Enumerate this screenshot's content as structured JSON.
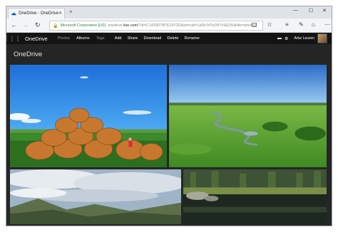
{
  "browser": {
    "tab_title": "OneDrive - OneDrive",
    "new_tab": "+",
    "address": {
      "certificate": "Microsoft Corporation [US]",
      "url_prefix": "onedrive.",
      "url_domain": "live.com",
      "url_rest": "/?id=C1430D7B7E1972D&sb=cid=1a5b7d7e1f57c9&259&ithr=photos"
    }
  },
  "suite_bar": {
    "app_name": "OneDrive",
    "nav": [
      "Photos",
      "Albums",
      "Tags"
    ],
    "actions": [
      "Add",
      "Share",
      "Download",
      "Delete",
      "Rename"
    ],
    "user_name": "Artur Leuven"
  },
  "album": {
    "title": "OneDrive"
  },
  "photos": [
    {
      "subject": "hay bales field"
    },
    {
      "subject": "green meadow with stream"
    },
    {
      "subject": "cloudy mountains"
    },
    {
      "subject": "lake with reflections"
    }
  ]
}
